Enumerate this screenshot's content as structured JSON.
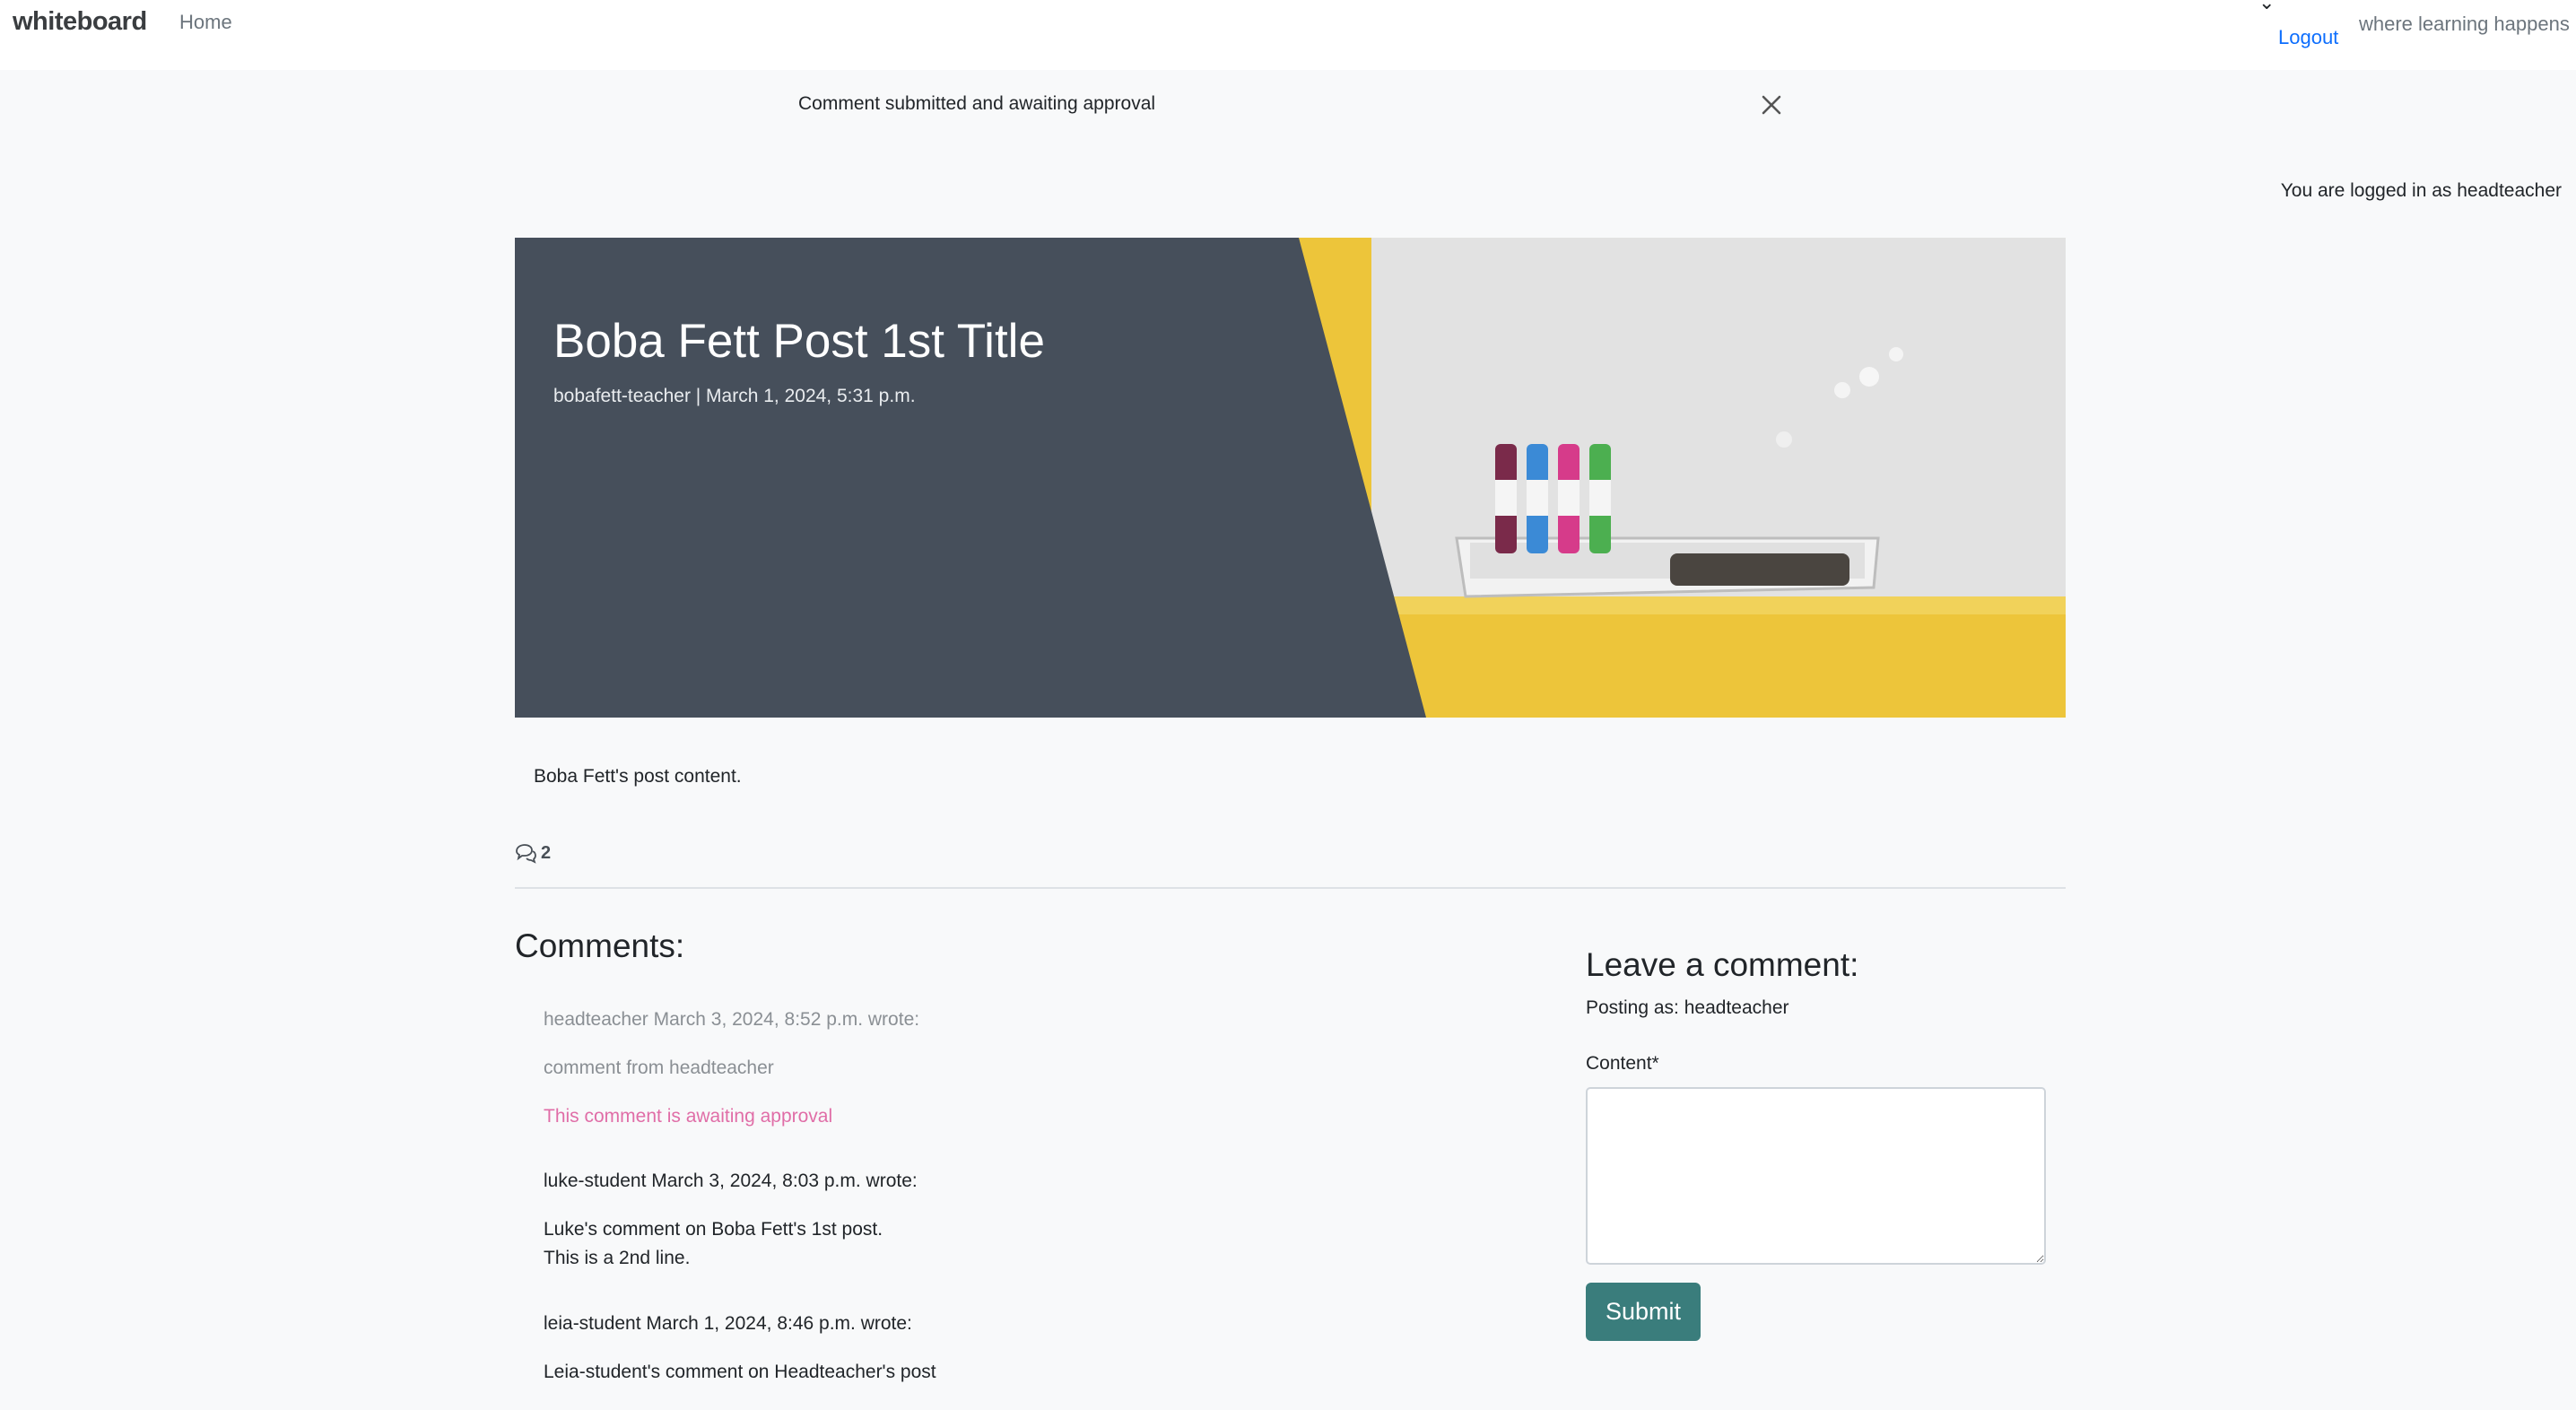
{
  "navbar": {
    "brand": "whiteboard",
    "home_label": "Home",
    "logout_label": "Logout",
    "tagline": "where learning happens"
  },
  "alert": {
    "message": "Comment submitted and awaiting approval"
  },
  "status": {
    "logged_in_text": "You are logged in as headteacher"
  },
  "post": {
    "title": "Boba Fett Post 1st Title",
    "meta": "bobafett-teacher | March 1, 2024, 5:31 p.m.",
    "content": "Boba Fett's post content.",
    "comment_count": "2",
    "hero_colors": {
      "panel": "#464f5b",
      "wall_yellow": "#edc53a",
      "whiteboard": "#dcdcdc"
    }
  },
  "comments": {
    "heading": "Comments:",
    "items": [
      {
        "author_line": "headteacher March 3, 2024, 8:52 p.m. wrote:",
        "body": "comment from headteacher",
        "approval_text": "This comment is awaiting approval"
      },
      {
        "author_line": "luke-student March 3, 2024, 8:03 p.m. wrote:",
        "body": "Luke's comment on Boba Fett's 1st post.\nThis is a 2nd line."
      },
      {
        "author_line": "leia-student March 1, 2024, 8:46 p.m. wrote:",
        "body": "Leia-student's comment on Headteacher's post"
      }
    ]
  },
  "comment_form": {
    "heading": "Leave a comment:",
    "posting_as": "Posting as: headteacher",
    "content_label": "Content*",
    "content_value": "",
    "submit_label": "Submit",
    "submit_color": "#3a7d7c"
  }
}
